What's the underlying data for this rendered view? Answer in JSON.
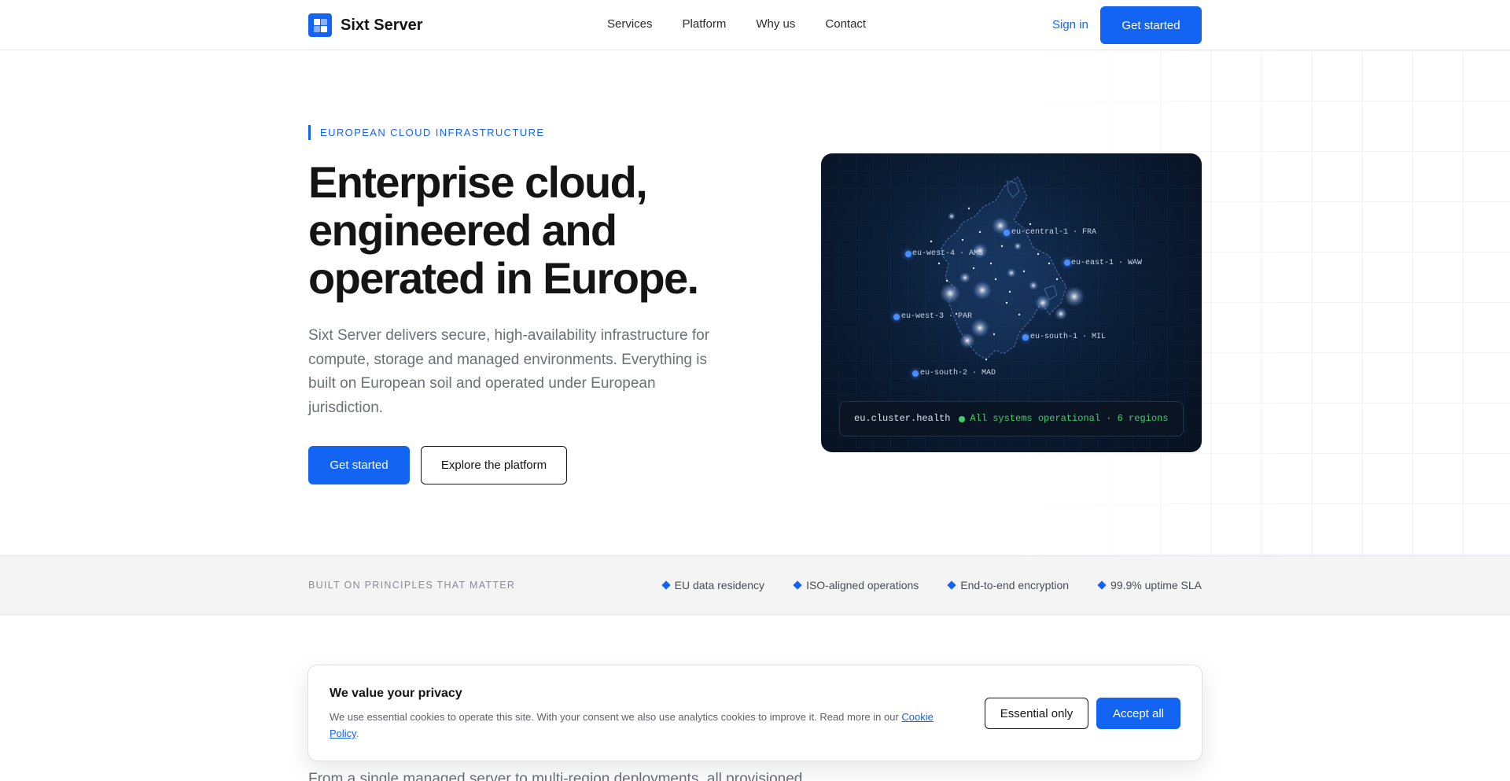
{
  "nav": {
    "brand": "Sixt Server",
    "links": [
      "Services",
      "Platform",
      "Why us",
      "Contact"
    ],
    "signin": "Sign in",
    "cta": "Get started"
  },
  "hero": {
    "eyebrow": "EUROPEAN CLOUD INFRASTRUCTURE",
    "title": "Enterprise cloud, engineered and operated in Europe.",
    "subtitle": "Sixt Server delivers secure, high-availability infrastructure for compute, storage and managed environments. Everything is built on European soil and operated under European jurisdiction.",
    "cta_primary": "Get started",
    "cta_secondary": "Explore the platform"
  },
  "map": {
    "regions": [
      "eu-central-1 · FRA",
      "eu-west-4 · AMS",
      "eu-east-1 · WAW",
      "eu-west-3 · PAR",
      "eu-south-1 · MIL",
      "eu-south-2 · MAD"
    ],
    "health_label": "eu.cluster.health",
    "health_status": "All systems operational · 6 regions",
    "accent": "#3b82f6",
    "status_color": "#3fcf6c"
  },
  "principles": {
    "label": "BUILT ON PRINCIPLES THAT MATTER",
    "items": [
      "EU data residency",
      "ISO-aligned operations",
      "End-to-end encryption",
      "99.9% uptime SLA"
    ]
  },
  "next_section": {
    "text": "From a single managed server to multi-region deployments, all provisioned"
  },
  "cookie": {
    "title": "We value your privacy",
    "text": "We use essential cookies to operate this site. With your consent we also use analytics cookies to improve it. Read more in our ",
    "link": "Cookie Policy",
    "suffix": ".",
    "essential": "Essential only",
    "accept": "Accept all"
  },
  "colors": {
    "brand": "#1464f4",
    "ink": "#141414",
    "muted": "#6b6f76"
  }
}
